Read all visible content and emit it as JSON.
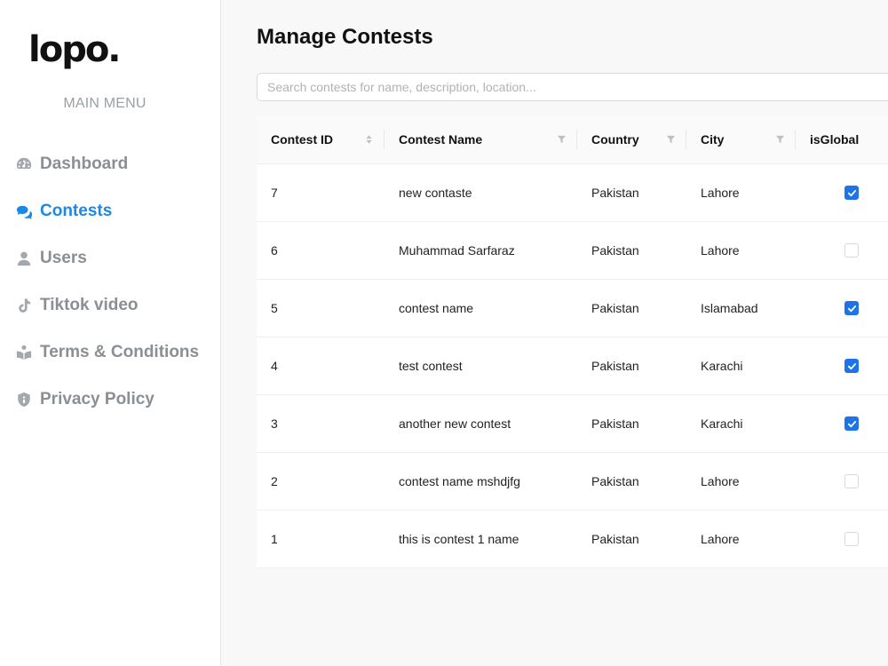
{
  "brand": {
    "logo_text": "lopo."
  },
  "sidebar": {
    "menu_title": "MAIN MENU",
    "items": [
      {
        "label": "Dashboard",
        "icon": "dashboard-icon",
        "active": false
      },
      {
        "label": "Contests",
        "icon": "comments-icon",
        "active": true
      },
      {
        "label": "Users",
        "icon": "user-icon",
        "active": false
      },
      {
        "label": "Tiktok video",
        "icon": "tiktok-icon",
        "active": false
      },
      {
        "label": "Terms & Conditions",
        "icon": "book-reader-icon",
        "active": false
      },
      {
        "label": "Privacy Policy",
        "icon": "shield-icon",
        "active": false
      }
    ]
  },
  "main": {
    "title": "Manage Contests",
    "search": {
      "placeholder": "Search contests for name, description, location...",
      "value": ""
    }
  },
  "table": {
    "columns": [
      "Contest ID",
      "Contest Name",
      "Country",
      "City",
      "isGlobal"
    ],
    "rows": [
      {
        "id": "7",
        "name": "new contaste",
        "country": "Pakistan",
        "city": "Lahore",
        "global": true
      },
      {
        "id": "6",
        "name": "Muhammad Sarfaraz",
        "country": "Pakistan",
        "city": "Lahore",
        "global": false
      },
      {
        "id": "5",
        "name": "contest name",
        "country": "Pakistan",
        "city": "Islamabad",
        "global": true
      },
      {
        "id": "4",
        "name": "test contest",
        "country": "Pakistan",
        "city": "Karachi",
        "global": true
      },
      {
        "id": "3",
        "name": "another new contest",
        "country": "Pakistan",
        "city": "Karachi",
        "global": true
      },
      {
        "id": "2",
        "name": "contest name mshdjfg",
        "country": "Pakistan",
        "city": "Lahore",
        "global": false
      },
      {
        "id": "1",
        "name": "this is contest 1 name",
        "country": "Pakistan",
        "city": "Lahore",
        "global": false
      }
    ]
  },
  "colors": {
    "accent": "#1e88e5",
    "checkbox": "#1e73e8",
    "muted": "#8a8f95"
  }
}
